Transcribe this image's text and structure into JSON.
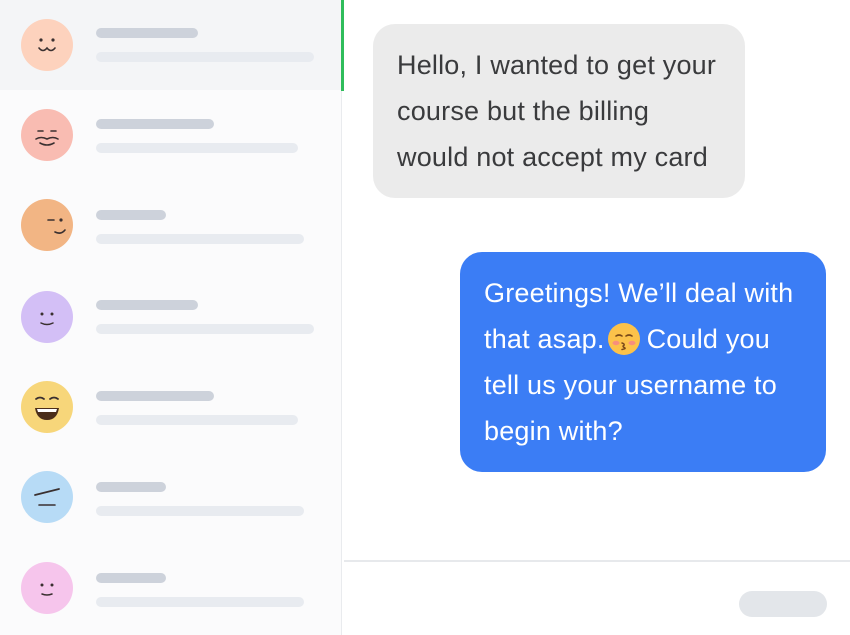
{
  "conversations": [
    {
      "avatar_color": "#fdd2bd",
      "face": "happy-face-icon"
    },
    {
      "avatar_color": "#f9bcb2",
      "face": "mustache-face-icon"
    },
    {
      "avatar_color": "#f2b584",
      "face": "wink-face-icon"
    },
    {
      "avatar_color": "#d3bff6",
      "face": "smile-face-icon"
    },
    {
      "avatar_color": "#f7d67a",
      "face": "laugh-face-icon"
    },
    {
      "avatar_color": "#b7dbf6",
      "face": "meh-face-icon"
    },
    {
      "avatar_color": "#f6c5ec",
      "face": "calm-face-icon"
    }
  ],
  "messages": {
    "incoming": "Hello, I wanted to get your course but the billing would not accept my card",
    "outgoing_part1": "Greetings! We’ll deal with that asap.",
    "outgoing_part2": "Could you tell us your username to begin with?"
  },
  "colors": {
    "active_marker": "#2fbd5b",
    "incoming_bubble": "#ebebeb",
    "outgoing_bubble": "#3b7df5"
  },
  "icons": {
    "message_emoji": "kissing-face-icon"
  }
}
